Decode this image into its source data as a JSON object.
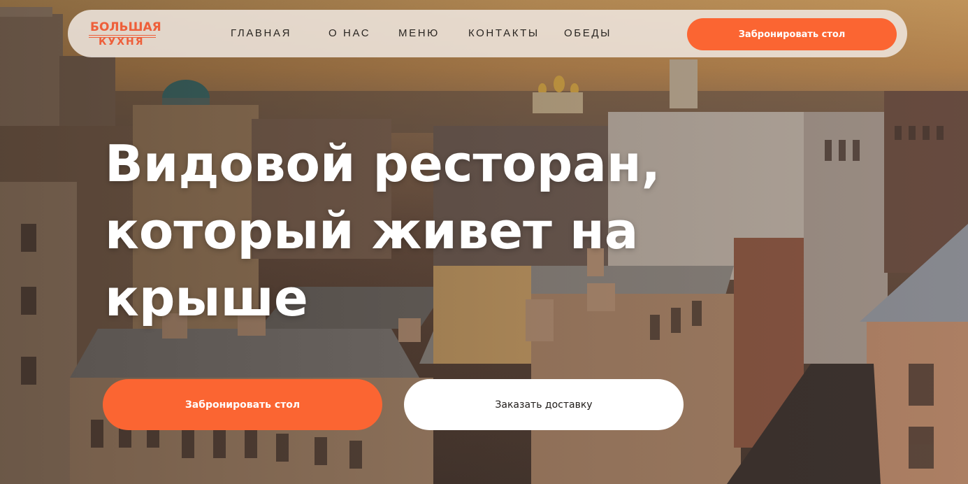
{
  "logo": {
    "line1": "БОЛЬШАЯ",
    "line2": "КУХНЯ"
  },
  "nav": {
    "items": [
      {
        "label": "ГЛАВНАЯ"
      },
      {
        "label": "О НАС"
      },
      {
        "label": "МЕНЮ"
      },
      {
        "label": "КОНТАКТЫ"
      },
      {
        "label": "ОБЕДЫ"
      }
    ],
    "cta_label": "Забронировать стол"
  },
  "hero": {
    "headline_lines": [
      "Видовой ресторан,",
      "который живет на",
      "крыше"
    ],
    "book_label": "Забронировать стол",
    "delivery_label": "Заказать доставку"
  },
  "colors": {
    "accent": "#fb6532",
    "logo": "#ee5f3a",
    "nav_bg": "#f0e8e1",
    "text_dark": "#2a2622",
    "white": "#ffffff"
  }
}
